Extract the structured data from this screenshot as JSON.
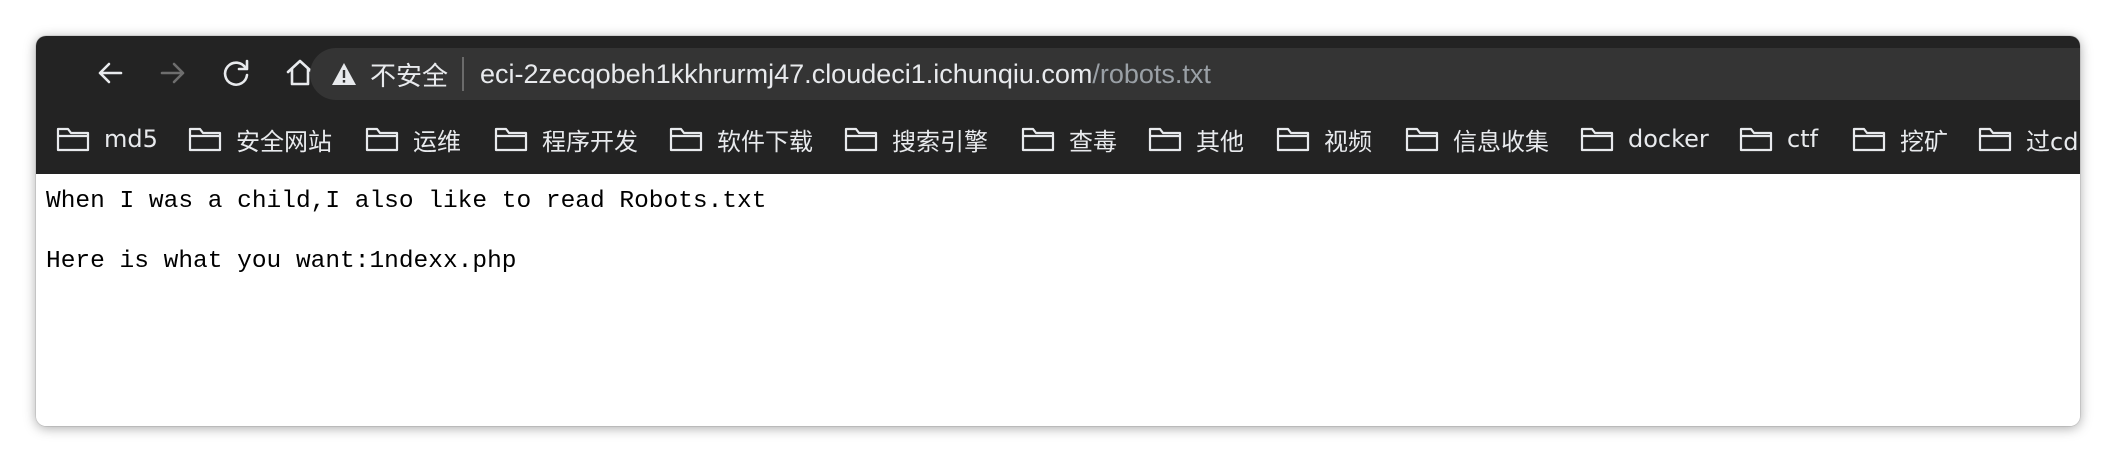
{
  "browser": {
    "security_label": "不安全",
    "url_host": "eci-2zecqobeh1kkhrurmj47.cloudeci1.ichunqiu.com",
    "url_path": "/robots.txt",
    "nav_icons": [
      "back-arrow-icon",
      "forward-arrow-icon",
      "reload-icon",
      "home-icon",
      "warning-icon"
    ],
    "colors": {
      "chrome_bg": "#232323",
      "omnibox_bg": "#343434",
      "text_primary": "#e8eaed",
      "text_muted": "#9aa0a6",
      "forward_disabled": "#6e6e6e"
    }
  },
  "bookmarks": [
    {
      "label": "md5"
    },
    {
      "label": "安全网站"
    },
    {
      "label": "运维"
    },
    {
      "label": "程序开发"
    },
    {
      "label": "软件下载"
    },
    {
      "label": "搜索引擎"
    },
    {
      "label": "查毒"
    },
    {
      "label": "其他"
    },
    {
      "label": "视频"
    },
    {
      "label": "信息收集"
    },
    {
      "label": "docker"
    },
    {
      "label": "ctf"
    },
    {
      "label": "挖矿"
    },
    {
      "label": "过cdn"
    }
  ],
  "page": {
    "line1": "When I was a child,I also like to read Robots.txt",
    "line2": "Here is what you want:1ndexx.php"
  }
}
